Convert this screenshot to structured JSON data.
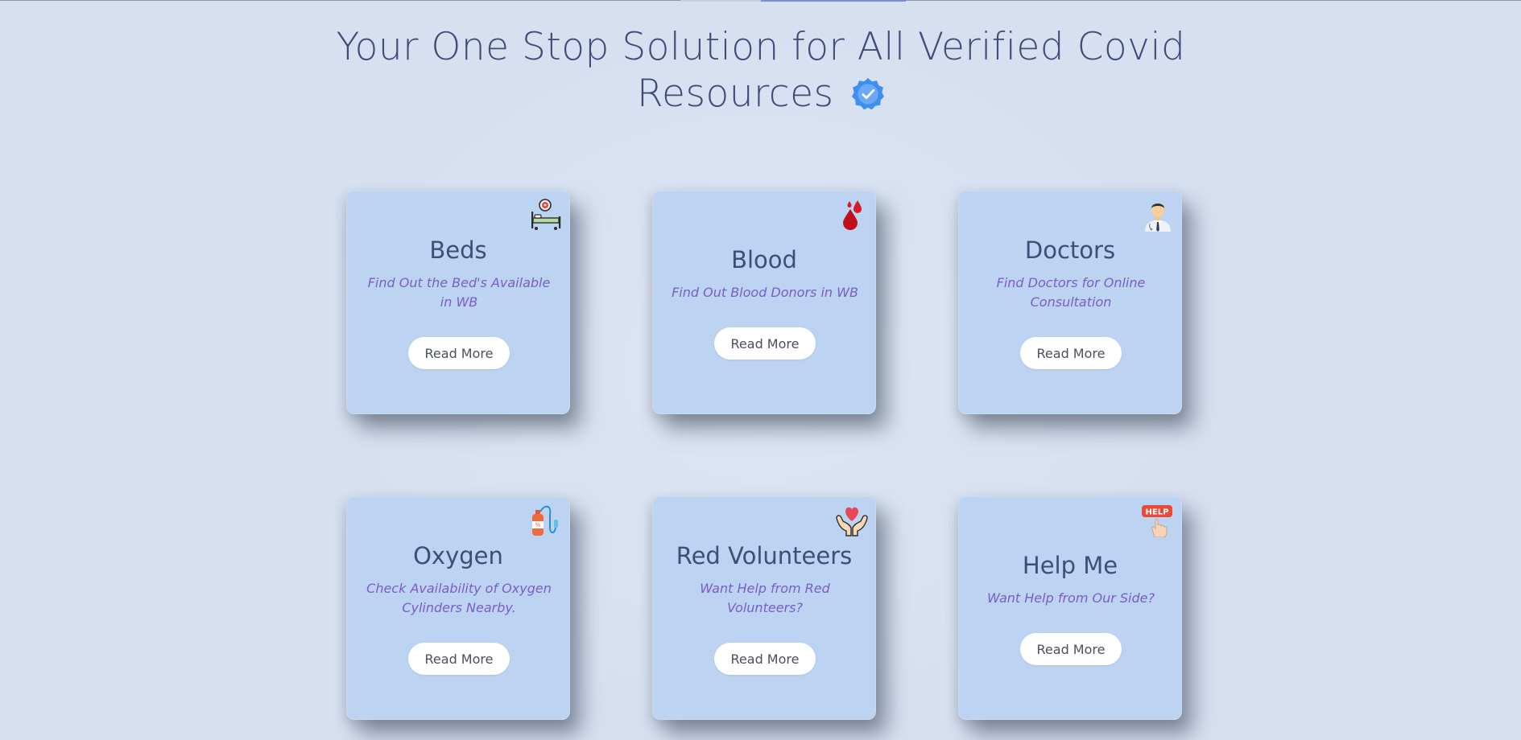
{
  "header": {
    "title_line1": "Your One Stop Solution for All Verified Covid",
    "title_line2": "Resources",
    "verified_icon": "verified-badge-icon"
  },
  "colors": {
    "background": "#d6e0f1",
    "card": "#bdd3f2",
    "title": "#414b78",
    "description": "#7a5dc6",
    "badge": "#3f8ef0"
  },
  "cards": [
    {
      "title": "Beds",
      "description": "Find Out the Bed's Available in WB",
      "button": "Read More",
      "icon": "hospital-bed-icon"
    },
    {
      "title": "Blood",
      "description": "Find Out Blood Donors in WB",
      "button": "Read More",
      "icon": "blood-drops-icon"
    },
    {
      "title": "Doctors",
      "description": "Find Doctors for Online Consultation",
      "button": "Read More",
      "icon": "doctor-icon"
    },
    {
      "title": "Oxygen",
      "description": "Check Availability of Oxygen Cylinders Nearby.",
      "button": "Read More",
      "icon": "oxygen-cylinder-icon"
    },
    {
      "title": "Red Volunteers",
      "description": "Want Help from Red Volunteers?",
      "button": "Read More",
      "icon": "heart-hands-icon"
    },
    {
      "title": "Help Me",
      "description": "Want Help from Our Side?",
      "button": "Read More",
      "icon": "help-hand-icon",
      "icon_text": "HELP"
    }
  ]
}
